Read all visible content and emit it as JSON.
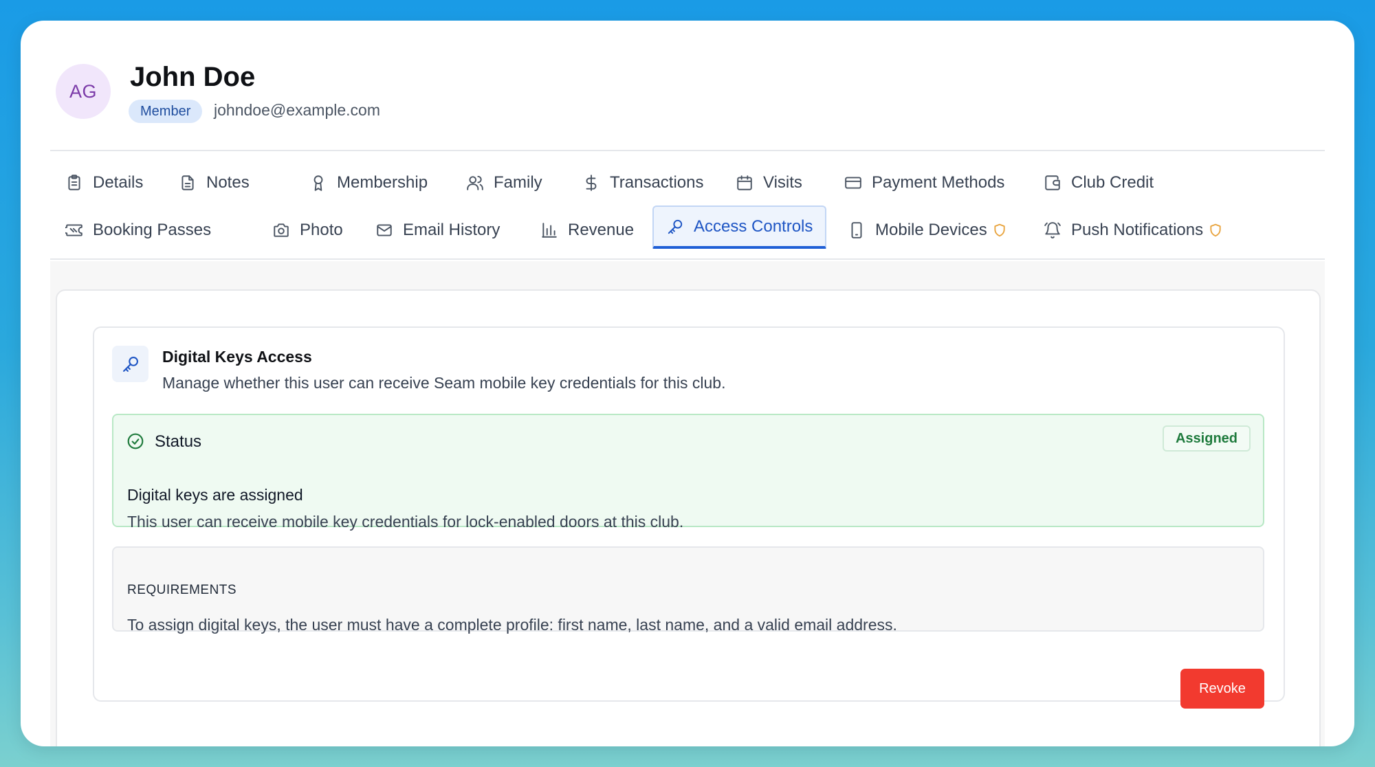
{
  "profile": {
    "avatar_initials": "AG",
    "name": "John Doe",
    "role": "Member",
    "email": "johndoe@example.com"
  },
  "tabs": [
    {
      "label": "Details",
      "icon": "clipboard-icon"
    },
    {
      "label": "Notes",
      "icon": "document-icon"
    },
    {
      "label": "Membership",
      "icon": "award-icon"
    },
    {
      "label": "Family",
      "icon": "users-icon"
    },
    {
      "label": "Transactions",
      "icon": "dollar-icon"
    },
    {
      "label": "Visits",
      "icon": "calendar-icon"
    },
    {
      "label": "Payment Methods",
      "icon": "credit-card-icon"
    },
    {
      "label": "Club Credit",
      "icon": "wallet-icon"
    },
    {
      "label": "Booking Passes",
      "icon": "ticket-icon"
    },
    {
      "label": "Photo",
      "icon": "camera-icon"
    },
    {
      "label": "Email History",
      "icon": "mail-icon"
    },
    {
      "label": "Revenue",
      "icon": "bar-chart-icon"
    },
    {
      "label": "Access Controls",
      "icon": "key-icon",
      "active": true
    },
    {
      "label": "Mobile Devices",
      "icon": "smartphone-icon",
      "badge_icon": "shield-icon"
    },
    {
      "label": "Push Notifications",
      "icon": "bell-icon",
      "badge_icon": "shield-icon"
    }
  ],
  "digital_keys": {
    "title": "Digital Keys Access",
    "subtitle": "Manage whether this user can receive Seam mobile key credentials for this club.",
    "status_label": "Status",
    "status_badge": "Assigned",
    "status_heading": "Digital keys are assigned",
    "status_description": "This user can receive mobile key credentials for lock-enabled doors at this club.",
    "requirements_title": "REQUIREMENTS",
    "requirements_text": "To assign digital keys, the user must have a complete profile: first name, last name, and a valid email address.",
    "revoke_label": "Revoke"
  },
  "colors": {
    "accent": "#1f5fd6",
    "success": "#1e7a3c",
    "danger": "#f23a2f",
    "warning": "#e8a23a"
  }
}
